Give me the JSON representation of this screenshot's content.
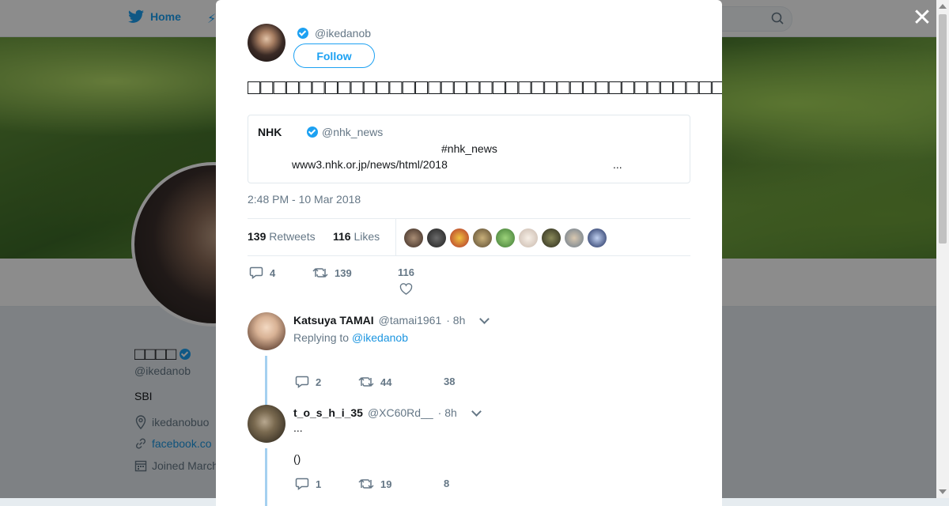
{
  "nav": {
    "home_label": "Home"
  },
  "profile": {
    "name": "□□□□",
    "handle": "@ikedanob",
    "bio": "SBI",
    "location": "ikedanobuo",
    "website": "facebook.co",
    "joined": "Joined March"
  },
  "tweet": {
    "author_handle": "@ikedanob",
    "follow_label": "Follow",
    "text": "□□□□□□□□□□□□□□□□□□□□□□□□□□□□□□□□□□□□□□□□□□□",
    "quote": {
      "name": "NHK",
      "handle": "@nhk_news",
      "hashtag": "#nhk_news",
      "url": "www3.nhk.or.jp/news/html/2018",
      "ellipsis": "..."
    },
    "timestamp": "2:48 PM - 10 Mar 2018",
    "retweets_count": "139",
    "retweets_label": "Retweets",
    "likes_count": "116",
    "likes_label": "Likes",
    "actions": {
      "replies": "4",
      "retweets": "139",
      "likes": "116"
    }
  },
  "replies": [
    {
      "name": "Katsuya TAMAI",
      "handle": "@tamai1961",
      "time": "· 8h",
      "replying_prefix": "Replying to",
      "replying_to": "@ikedanob",
      "replies": "2",
      "retweets": "44",
      "likes": "38"
    },
    {
      "name": "t_o_s_h_i_35",
      "handle": "@XC60Rd__",
      "time": "· 8h",
      "line1": "...",
      "line2": "()",
      "replies": "1",
      "retweets": "19",
      "likes": "8"
    }
  ],
  "colors": {
    "accent": "#1da1f2",
    "link": "#1b95e0",
    "text": "#14171a",
    "muted": "#657786",
    "thread": "#a5d0f0"
  }
}
